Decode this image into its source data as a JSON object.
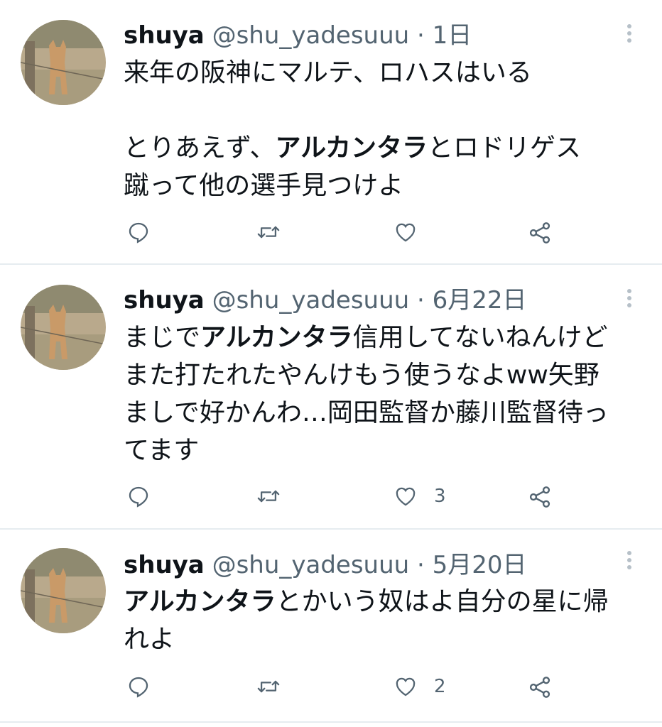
{
  "colors": {
    "text": "#0f1419",
    "secondary": "#536471",
    "separator": "#e6ecf0"
  },
  "tweets": [
    {
      "name": "shuya",
      "handle": "@shu_yadesuuu",
      "dot": "·",
      "time": "1日",
      "lines": [
        [
          {
            "text": "来年の阪神にマルテ、ロハスはいる",
            "bold": false
          }
        ],
        [],
        [
          {
            "text": "とりあえず、",
            "bold": false
          },
          {
            "text": "アルカンタラ",
            "bold": true
          },
          {
            "text": "とロドリゲス",
            "bold": false
          }
        ],
        [
          {
            "text": "蹴って他の選手見つけよ",
            "bold": false
          }
        ]
      ],
      "likes": ""
    },
    {
      "name": "shuya",
      "handle": "@shu_yadesuuu",
      "dot": "·",
      "time": "6月22日",
      "lines": [
        [
          {
            "text": "まじで",
            "bold": false
          },
          {
            "text": "アルカンタラ",
            "bold": true
          },
          {
            "text": "信用してないねんけど",
            "bold": false
          }
        ],
        [
          {
            "text": "また打たれたやんけもう使うなよww矢野",
            "bold": false
          }
        ],
        [
          {
            "text": "ましで好かんわ…岡田監督か藤川監督待っ",
            "bold": false
          }
        ],
        [
          {
            "text": "てます",
            "bold": false
          }
        ]
      ],
      "likes": "3"
    },
    {
      "name": "shuya",
      "handle": "@shu_yadesuuu",
      "dot": "·",
      "time": "5月20日",
      "lines": [
        [
          {
            "text": "アルカンタラ",
            "bold": true
          },
          {
            "text": "とかいう奴はよ自分の星に帰",
            "bold": false
          }
        ],
        [
          {
            "text": "れよ",
            "bold": false
          }
        ]
      ],
      "likes": "2"
    }
  ],
  "icons": [
    "reply-icon",
    "retweet-icon",
    "like-icon",
    "share-icon",
    "more-options-icon"
  ]
}
